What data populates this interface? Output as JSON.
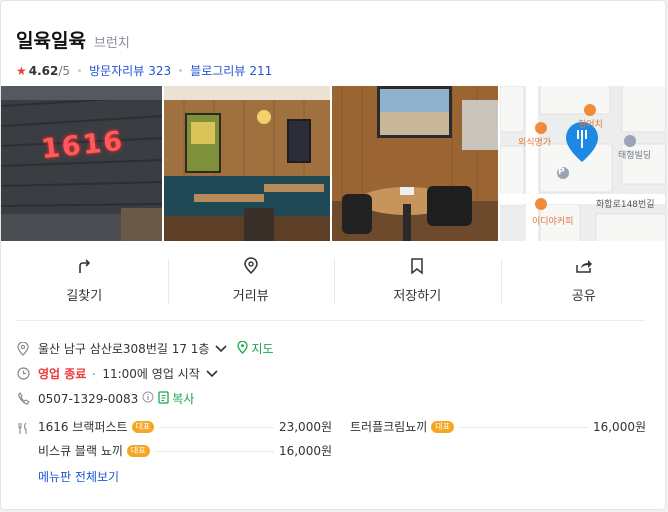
{
  "place": {
    "name": "일육일육",
    "category": "브런치",
    "rating_value": "4.62",
    "rating_max": "/5",
    "visitor_review_label": "방문자리뷰",
    "visitor_review_count": "323",
    "blog_review_label": "블로그리뷰",
    "blog_review_count": "211"
  },
  "photos": {
    "sign_text": "1616",
    "map_labels": {
      "restaurant1": "외식명가",
      "restaurant2": "청어치",
      "building": "태형빌딩",
      "street": "화합로148번길",
      "cafe": "이디야커피",
      "parking": "P"
    }
  },
  "actions": [
    {
      "label": "길찾기",
      "icon": "directions-icon"
    },
    {
      "label": "거리뷰",
      "icon": "streetview-pin-icon"
    },
    {
      "label": "저장하기",
      "icon": "bookmark-icon"
    },
    {
      "label": "공유",
      "icon": "share-icon"
    }
  ],
  "info": {
    "address": "울산 남구 삼산로308번길 17 1층",
    "map_link": "지도",
    "status": "영업 종료",
    "next_open": "11:00에 영업 시작",
    "phone": "0507-1329-0083",
    "copy": "복사"
  },
  "menu": {
    "items": [
      {
        "name": "1616 브랙퍼스트",
        "badge": "대표",
        "price": "23,000원"
      },
      {
        "name": "트러플크림뇨끼",
        "badge": "대표",
        "price": "16,000원"
      },
      {
        "name": "비스큐 블랙 뇨끼",
        "badge": "대표",
        "price": "16,000원"
      }
    ],
    "view_all": "메뉴판 전체보기"
  },
  "colors": {
    "link_blue": "#2155d6",
    "status_red": "#ee3b3b",
    "map_green": "#1aa84c",
    "badge_orange": "#f5a623",
    "map_pin_blue": "#1e88e5"
  }
}
